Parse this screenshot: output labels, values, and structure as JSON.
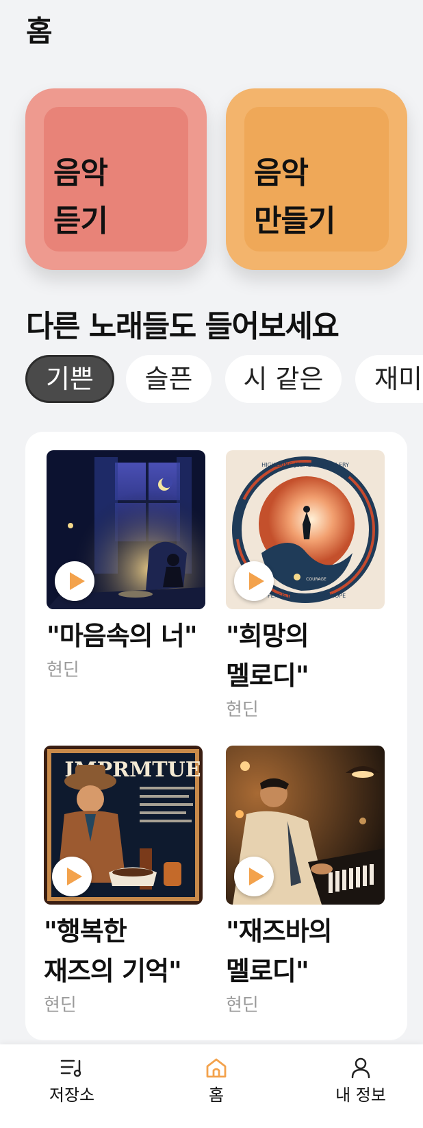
{
  "header": {
    "title": "홈"
  },
  "actions": {
    "listen": {
      "line1": "음악",
      "line2": "듣기"
    },
    "create": {
      "line1": "음악",
      "line2": "만들기"
    }
  },
  "section": {
    "title": "다른 노래들도 들어보세요"
  },
  "moods": {
    "selected": "기쁜",
    "chips": [
      "기쁜",
      "슬픈",
      "시 같은",
      "재미"
    ]
  },
  "songs": [
    {
      "title": "\"마음속의 너\"",
      "artist": "현딘"
    },
    {
      "title": "\"희망의 멜로디\"",
      "artist": "현딘",
      "cover_text": [
        "HIGHERING JEEMER WITHIN ERY",
        "PERSISTNT MIALCE OF HOPE",
        "COURAGE"
      ]
    },
    {
      "title": "\"행복한 재즈의 기억\"",
      "artist": "현딘",
      "cover_text": [
        "IMPRMTUE"
      ]
    },
    {
      "title": "\"재즈바의 멜로디\"",
      "artist": "현딘"
    }
  ],
  "nav": {
    "items": [
      {
        "label": "저장소",
        "icon": "library-icon"
      },
      {
        "label": "홈",
        "icon": "home-icon"
      },
      {
        "label": "내 정보",
        "icon": "profile-icon"
      }
    ],
    "active_color": "#f3a24c"
  }
}
